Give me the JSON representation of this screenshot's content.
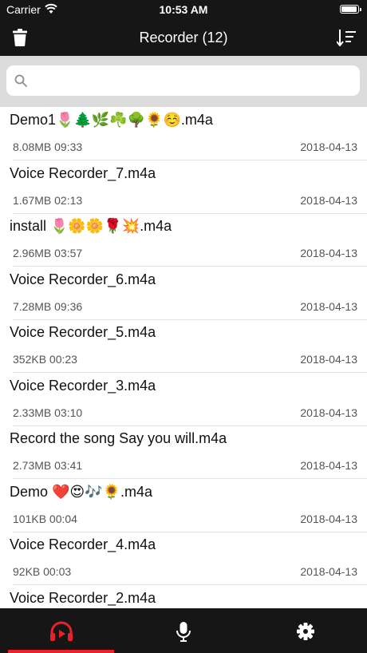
{
  "status": {
    "carrier": "Carrier",
    "time": "10:53 AM"
  },
  "header": {
    "title": "Recorder (12)"
  },
  "search": {
    "placeholder": ""
  },
  "recordings": [
    {
      "name": "Demo1🌷🌲🌿☘️🌳🌻☺️.m4a",
      "meta": "8.08MB 09:33",
      "date": "2018-04-13"
    },
    {
      "name": "Voice Recorder_7.m4a",
      "meta": "1.67MB 02:13",
      "date": "2018-04-13"
    },
    {
      "name": "install 🌷🌼🌼🌹💥.m4a",
      "meta": "2.96MB 03:57",
      "date": "2018-04-13"
    },
    {
      "name": "Voice Recorder_6.m4a",
      "meta": "7.28MB 09:36",
      "date": "2018-04-13"
    },
    {
      "name": "Voice Recorder_5.m4a",
      "meta": "352KB 00:23",
      "date": "2018-04-13"
    },
    {
      "name": "Voice Recorder_3.m4a",
      "meta": "2.33MB 03:10",
      "date": "2018-04-13"
    },
    {
      "name": "Record the song Say you will.m4a",
      "meta": "2.73MB 03:41",
      "date": "2018-04-13"
    },
    {
      "name": "Demo ❤️😍🎶🌻.m4a",
      "meta": "101KB 00:04",
      "date": "2018-04-13"
    },
    {
      "name": "Voice Recorder_4.m4a",
      "meta": "92KB 00:03",
      "date": "2018-04-13"
    },
    {
      "name": "Voice Recorder_2.m4a",
      "meta": "",
      "date": ""
    }
  ],
  "tabs": [
    {
      "icon": "headphones-play-icon",
      "active": true
    },
    {
      "icon": "microphone-icon",
      "active": false
    },
    {
      "icon": "gear-icon",
      "active": false
    }
  ],
  "colors": {
    "bar": "#161616",
    "accent": "#e8222b",
    "search_bg": "#dcdcdc"
  }
}
